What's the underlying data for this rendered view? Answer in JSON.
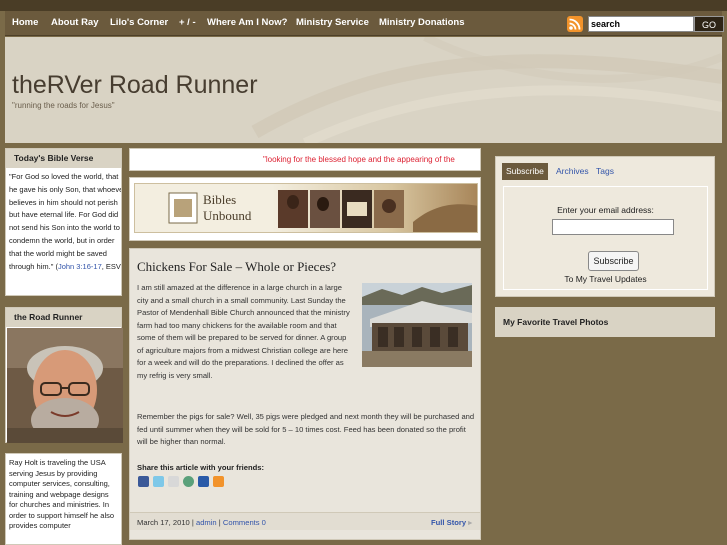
{
  "nav": {
    "items": [
      "Home",
      "About Ray",
      "Lilo's Corner",
      "+ / -",
      "Where Am I Now?",
      "Ministry Service",
      "Ministry Donations"
    ],
    "search_value": "search",
    "search_button": "GO"
  },
  "header": {
    "title": "theRVer Road Runner",
    "tagline": "\"running the roads for Jesus\""
  },
  "sidebar": {
    "verse_title": "Today's Bible Verse",
    "verse_text": "\"For God so loved the world, that he gave his only Son, that whoever believes in him should not perish but have eternal life. For God did not send his Son into the world to condemn the world, but in order that the world might be saved through him.\"",
    "verse_ref": "John 3:16-17",
    "verse_version": ", ESV)",
    "verse_open": "(",
    "road_runner_title": "the Road Runner",
    "bio": "Ray Holt is traveling the USA serving Jesus by providing computer services, consulting, training and webpage designs for churches and ministries. In order to support himself he also provides computer"
  },
  "marquee": {
    "text": "\"looking for the blessed hope and the appearing of the"
  },
  "banner": {
    "line1": "Bibles",
    "line2": "Unbound"
  },
  "post": {
    "title": "Chickens For Sale – Whole or Pieces?",
    "p1": "I am still amazed at the difference in a large church in a large city and a small church in a small community. Last Sunday the Pastor of Mendenhall Bible Church announced that the ministry farm had too many chickens for the available room and that some of them will be prepared to be served for dinner. A group of agriculture majors from a midwest Christian college are here for a week and will do the preparations.  I declined the offer as my refrig is very small.",
    "p2": "Remember the pigs for sale? Well, 35 pigs were pledged and next month they will be purchased and fed until summer when they will be sold for 5 – 10 times cost. Feed has been donated so the profit will be higher than normal.",
    "share_label": "Share this article with your friends:",
    "date": "March 17, 2010 | ",
    "author": "admin",
    "sep": " | ",
    "comments": "Comments 0",
    "full_story": "Full Story"
  },
  "subscribe": {
    "tabs": [
      "Subscribe",
      "Archives",
      "Tags"
    ],
    "email_label": "Enter your email address:",
    "button": "Subscribe",
    "note": "To My Travel Updates"
  },
  "photos_panel": {
    "title": "My Favorite Travel Photos"
  },
  "colors": {
    "nav_bg": "#6b5a3d",
    "page_bg": "#7a6a48",
    "header_bg": "#d9d3c4",
    "marquee_text": "#dd2233",
    "link": "#3355aa"
  }
}
